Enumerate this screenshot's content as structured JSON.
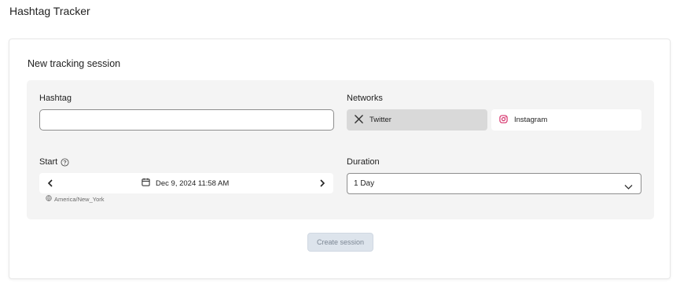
{
  "app": {
    "title": "Hashtag Tracker"
  },
  "form": {
    "title": "New tracking session",
    "hashtag": {
      "label": "Hashtag",
      "value": "",
      "placeholder": ""
    },
    "networks": {
      "label": "Networks",
      "options": [
        {
          "label": "Twitter",
          "icon": "x-logo-icon",
          "selected": true
        },
        {
          "label": "Instagram",
          "icon": "instagram-icon",
          "selected": false
        }
      ]
    },
    "start": {
      "label": "Start",
      "help_icon": "help-circle-icon",
      "value": "Dec 9, 2024 11:58 AM",
      "timezone": "America/New_York"
    },
    "duration": {
      "label": "Duration",
      "value": "1 Day"
    },
    "submit_label": "Create session"
  },
  "colors": {
    "panel_bg": "#f4f4f4",
    "selected_network_bg": "#d9d9d9",
    "instagram_pink": "#d6336c",
    "disabled_button_bg": "#dde4ec",
    "disabled_button_text": "#7c8794"
  }
}
